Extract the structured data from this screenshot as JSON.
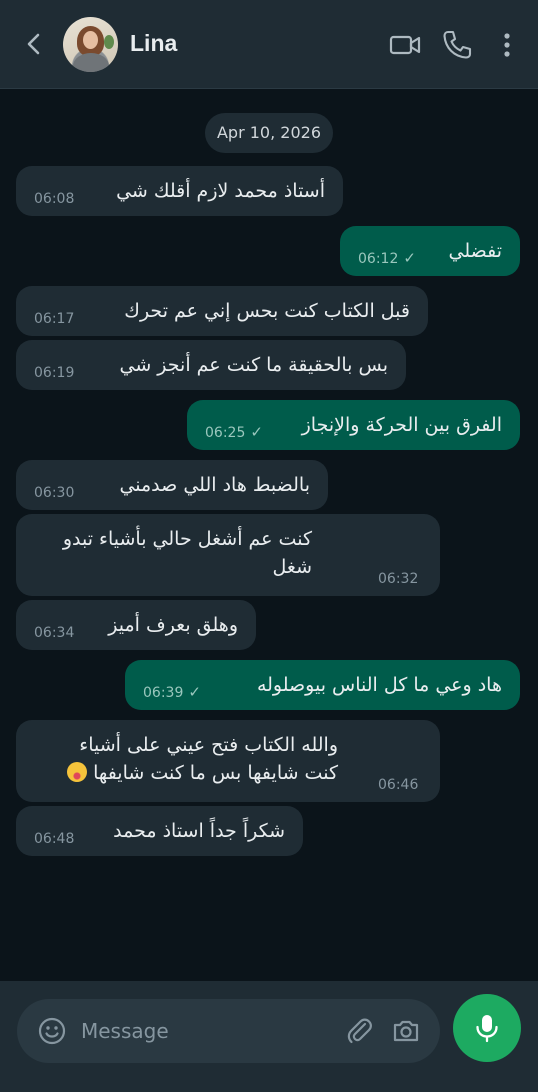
{
  "header": {
    "contact_name": "Lina",
    "icons": [
      "back-arrow",
      "avatar",
      "video-call",
      "voice-call",
      "more-menu"
    ]
  },
  "chat": {
    "date": "Apr 10, 2026",
    "messages": [
      {
        "dir": "in",
        "text": "أستاذ محمد لازم أقلك شي",
        "time": "06:08"
      },
      {
        "dir": "out",
        "text": "تفضلي",
        "time": "06:12"
      },
      {
        "dir": "in",
        "text": "قبل الكتاب كنت بحس إني عم تحرك",
        "time": "06:17"
      },
      {
        "dir": "in",
        "text": "بس بالحقيقة ما كنت عم أنجز شي",
        "time": "06:19"
      },
      {
        "dir": "out",
        "text": "الفرق بين الحركة والإنجاز",
        "time": "06:25"
      },
      {
        "dir": "in",
        "text": "بالضبط هاد اللي صدمني",
        "time": "06:30"
      },
      {
        "dir": "in",
        "text": "كنت عم أشغل حالي بأشياء تبدو\nشغل",
        "time": "06:32"
      },
      {
        "dir": "in",
        "text": "وهلق بعرف أميز",
        "time": "06:34"
      },
      {
        "dir": "out",
        "text": "هاد وعي ما كل الناس بيوصلوله",
        "time": "06:39"
      },
      {
        "dir": "in",
        "text": "والله الكتاب فتح عيني على أشياء\nكنت شايفها بس ما كنت شايفها",
        "time": "06:46"
      },
      {
        "dir": "in",
        "text": "شكراً جداً استاذ محمد",
        "time": "06:48"
      }
    ]
  },
  "composer": {
    "placeholder": "Message",
    "colors": {
      "send_button": "#1daa61",
      "outgoing_bubble": "#005c4b",
      "incoming_bubble": "#1f2c34"
    }
  }
}
